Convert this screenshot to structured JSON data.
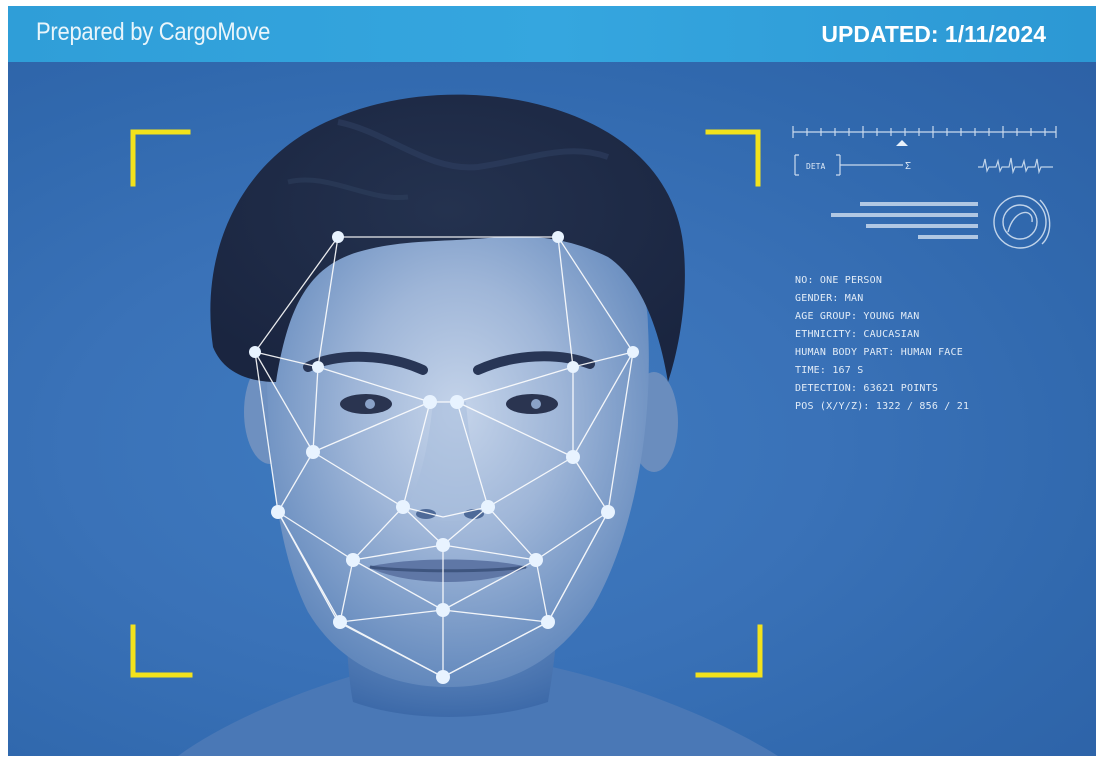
{
  "header": {
    "brand": "Prepared by CargoMove",
    "updated": "UPDATED: 1/11/2024"
  },
  "scan_panel": {
    "lines": [
      "NO: ONE PERSON",
      "GENDER: MAN",
      "AGE GROUP: YOUNG MAN",
      "ETHNICITY: CAUCASIAN",
      "HUMAN BODY PART: HUMAN FACE",
      "TIME: 167 S",
      "DETECTION: 63621 POINTS",
      "POS (X/Y/Z): 1322 / 856 / 21"
    ]
  },
  "colors": {
    "header_bar": "#2f9ed8",
    "background_blue": "#3a72b8",
    "corner_brackets": "#f2e21c",
    "mesh_lines": "#ffffff"
  },
  "icons": [
    "ruler-scale-icon",
    "waveform-icon",
    "target-rings-icon",
    "corner-bracket-icon"
  ]
}
